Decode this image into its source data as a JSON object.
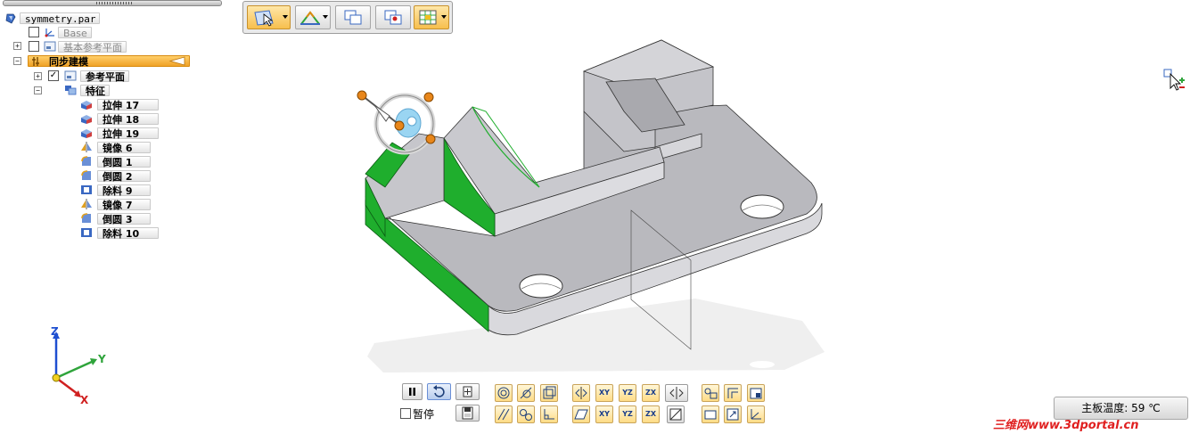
{
  "tree": {
    "file_name": "symmetry.par",
    "base_label": "Base",
    "base_ref_planes_label": "基本参考平面",
    "sync_label": "同步建模",
    "ref_planes_label": "参考平面",
    "features_label": "特征",
    "features": [
      {
        "label": "拉伸 17",
        "icon": "extrude-icon"
      },
      {
        "label": "拉伸 18",
        "icon": "extrude-icon"
      },
      {
        "label": "拉伸 19",
        "icon": "extrude-icon"
      },
      {
        "label": "镜像 6",
        "icon": "mirror-icon"
      },
      {
        "label": "倒圆 1",
        "icon": "round-icon"
      },
      {
        "label": "倒圆 2",
        "icon": "round-icon"
      },
      {
        "label": "除料 9",
        "icon": "cutout-icon"
      },
      {
        "label": "镜像 7",
        "icon": "mirror-icon"
      },
      {
        "label": "倒圆 3",
        "icon": "round-icon"
      },
      {
        "label": "除料 10",
        "icon": "cutout-icon"
      }
    ],
    "expander_plus": "+",
    "expander_minus": "−",
    "check_mark": "✓"
  },
  "axes": {
    "z": "Z",
    "y": "Y",
    "x": "X"
  },
  "playback": {
    "pause_label": "暂停"
  },
  "toolbar_groups": {
    "plane_labels": [
      "XY",
      "YZ",
      "ZX"
    ]
  },
  "status": {
    "temperature": "主板温度: 59 ℃"
  },
  "watermark": "三维网www.3dportal.cn",
  "colors": {
    "accent_orange": "#f0a227",
    "face_green": "#1fae2d",
    "part_grey": "#c8c8cc",
    "watermark_red": "#e02020"
  }
}
